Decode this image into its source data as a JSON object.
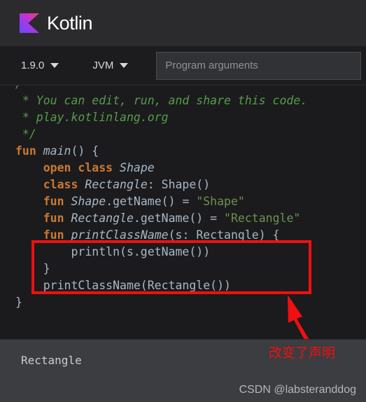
{
  "header": {
    "brand": "Kotlin",
    "logo_icon": "kotlin-logo-icon",
    "logo_gradient_from": "#7f52ff",
    "logo_gradient_to": "#e8446a"
  },
  "toolbar": {
    "version": "1.9.0",
    "target": "JVM",
    "caret_icon": "chevron-down-icon",
    "program_arguments_placeholder": "Program arguments",
    "program_arguments_value": ""
  },
  "editor": {
    "language": "kotlin",
    "colors": {
      "background": "#1b1b1d",
      "keyword": "#cc7832",
      "string": "#6a9153",
      "comment": "#579b4c",
      "plain": "#a9b7c6"
    },
    "lines": [
      [
        {
          "t": "/**",
          "c": "c"
        }
      ],
      [
        {
          "t": " * You can edit, run, and share this code.",
          "c": "c"
        }
      ],
      [
        {
          "t": " * play.kotlinlang.org",
          "c": "c"
        }
      ],
      [
        {
          "t": " */",
          "c": "c"
        }
      ],
      [
        {
          "t": "fun ",
          "c": "k"
        },
        {
          "t": "main",
          "c": "t"
        },
        {
          "t": "() {",
          "c": "p"
        }
      ],
      [
        {
          "t": "    ",
          "c": "p"
        },
        {
          "t": "open class ",
          "c": "k"
        },
        {
          "t": "Shape",
          "c": "t"
        }
      ],
      [
        {
          "t": "    ",
          "c": "p"
        },
        {
          "t": "class ",
          "c": "k"
        },
        {
          "t": "Rectangle",
          "c": "t"
        },
        {
          "t": ": Shape()",
          "c": "p"
        }
      ],
      [
        {
          "t": "    ",
          "c": "p"
        },
        {
          "t": "fun ",
          "c": "k"
        },
        {
          "t": "Shape",
          "c": "t"
        },
        {
          "t": ".getName() = ",
          "c": "p"
        },
        {
          "t": "\"Shape\"",
          "c": "s"
        }
      ],
      [
        {
          "t": "    ",
          "c": "p"
        },
        {
          "t": "fun ",
          "c": "k"
        },
        {
          "t": "Rectangle",
          "c": "t"
        },
        {
          "t": ".getName() = ",
          "c": "p"
        },
        {
          "t": "\"Rectangle\"",
          "c": "s"
        }
      ],
      [
        {
          "t": "    ",
          "c": "p"
        },
        {
          "t": "fun ",
          "c": "k"
        },
        {
          "t": "printClassName",
          "c": "t"
        },
        {
          "t": "(s: Rectangle) {",
          "c": "p"
        }
      ],
      [
        {
          "t": "        println(s.getName())",
          "c": "p"
        }
      ],
      [
        {
          "t": "    }",
          "c": "p"
        }
      ],
      [
        {
          "t": "    printClassName(Rectangle())",
          "c": "p"
        }
      ],
      [
        {
          "t": "}",
          "c": "p"
        }
      ]
    ]
  },
  "annotation": {
    "color": "#f10f0f",
    "box_label": "highlight-box-printClassName",
    "arrow_label": "annotation-arrow",
    "note_text": "改变了声明"
  },
  "output": {
    "text": "Rectangle",
    "watermark": "CSDN @labsteranddog"
  }
}
